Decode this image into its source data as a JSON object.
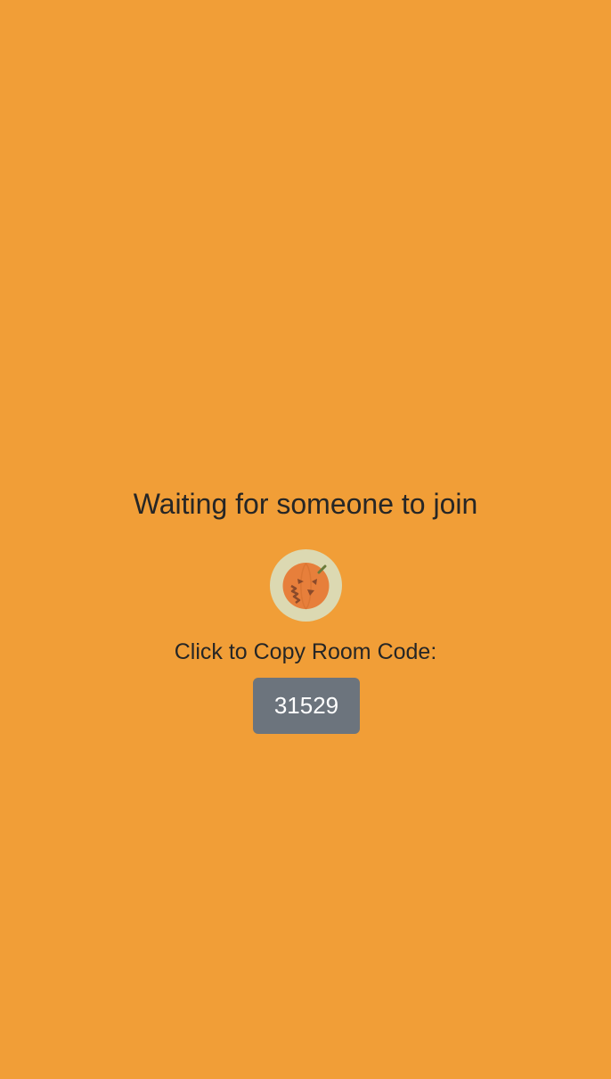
{
  "waiting": {
    "title": "Waiting for someone to join",
    "avatar_icon": "jack-o-lantern-icon",
    "copy_label": "Click to Copy Room Code:",
    "room_code": "31529"
  },
  "colors": {
    "background": "#f19e37",
    "avatar_background": "#dcd9b2",
    "pumpkin": "#e77f3b",
    "pumpkin_face": "#8b4a2a",
    "button_background": "#6c747d",
    "text": "#262626"
  }
}
